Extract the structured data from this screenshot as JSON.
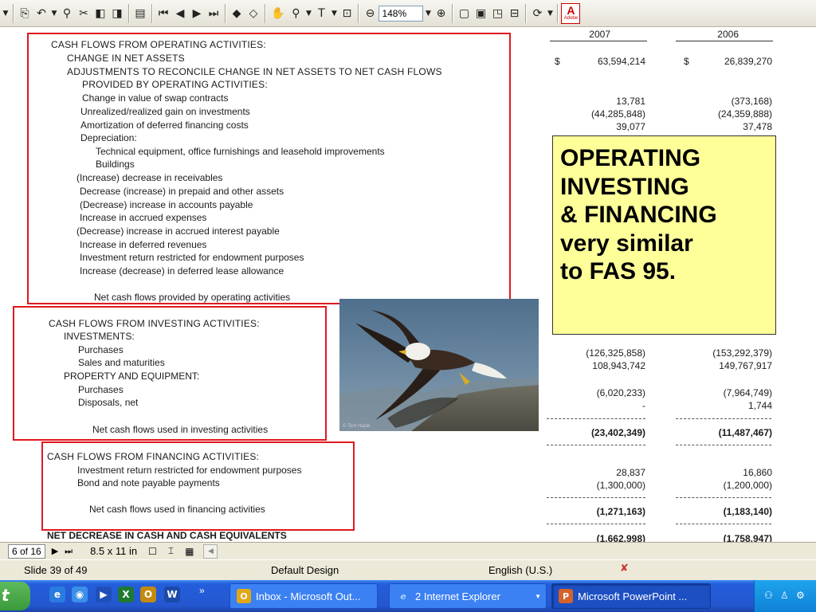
{
  "toolbar": {
    "zoom": "148%",
    "icons": [
      "dropdown-arrow-icon",
      "copy-icon",
      "undo-icon",
      "find-icon",
      "attach-icon",
      "insert-page-icon",
      "extract-page-icon",
      "pages-panel-icon",
      "first-page-icon",
      "prev-page-icon",
      "next-page-icon",
      "last-page-icon",
      "back-view-icon",
      "forward-view-icon",
      "hand-tool-icon",
      "zoom-tool-icon",
      "text-select-icon",
      "snapshot-icon",
      "zoom-out-icon",
      "zoom-in-icon",
      "actual-size-icon",
      "fit-page-icon",
      "fit-width-icon",
      "reflow-icon",
      "rotate-icon",
      "adobe-logo-icon"
    ],
    "adobe_label": "Adobe"
  },
  "columns": {
    "year1": "2007",
    "year2": "2006"
  },
  "operating": {
    "heading": "CASH FLOWS FROM OPERATING ACTIVITIES:",
    "change_net_assets": "CHANGE IN NET ASSETS",
    "adjustments_1": "ADJUSTMENTS TO RECONCILE CHANGE IN NET ASSETS TO NET CASH FLOWS",
    "adjustments_2": "PROVIDED BY OPERATING ACTIVITIES:",
    "swap": "Change in value of swap contracts",
    "gain": "Unrealized/realized gain on investments",
    "amortization": "Amortization of deferred financing costs",
    "depreciation": "Depreciation:",
    "technical": "Technical equipment, office furnishings and leasehold improvements",
    "buildings": "Buildings",
    "receivables": "(Increase) decrease in receivables",
    "prepaid": "Decrease (increase) in prepaid and other assets",
    "payable": "(Decrease) increase in accounts payable",
    "accrued": "Increase  in accrued expenses",
    "interest": "(Decrease) increase  in accrued interest payable",
    "deferred": "Increase  in deferred revenues",
    "endowment": "Investment return restricted for endowment purposes",
    "lease": "Increase (decrease) in deferred lease allowance",
    "net": "Net cash flows provided by operating activities"
  },
  "investing": {
    "heading": "CASH FLOWS FROM INVESTING ACTIVITIES:",
    "investments": "INVESTMENTS:",
    "purchases": "Purchases",
    "sales": "Sales and maturities",
    "property": "PROPERTY AND EQUIPMENT:",
    "purchases2": "Purchases",
    "disposals": "Disposals, net",
    "net": "Net cash flows used in investing activities"
  },
  "financing": {
    "heading": "CASH FLOWS FROM FINANCING ACTIVITIES:",
    "endowment": "Investment return restricted for endowment purposes",
    "bond": "Bond and note payable payments",
    "net": "Net cash flows used in financing activities",
    "decrease": "NET DECREASE IN CASH AND CASH EQUIVALENTS"
  },
  "values": {
    "change_net_assets": [
      "63,594,214",
      "26,839,270"
    ],
    "dollar": "$",
    "swap": [
      "13,781",
      "(373,168)"
    ],
    "gain": [
      "(44,285,848)",
      "(24,359,888)"
    ],
    "amortization": [
      "39,077",
      "37,478"
    ],
    "inv_purchases": [
      "(126,325,858)",
      "(153,292,379)"
    ],
    "inv_sales": [
      "108,943,742",
      "149,767,917"
    ],
    "prop_purchases": [
      "(6,020,233)",
      "(7,964,749)"
    ],
    "disposals": [
      "-",
      "1,744"
    ],
    "net_investing": [
      "(23,402,349)",
      "(11,487,467)"
    ],
    "fin_endowment": [
      "28,837",
      "16,860"
    ],
    "bond": [
      "(1,300,000)",
      "(1,200,000)"
    ],
    "net_financing": [
      "(1,271,163)",
      "(1,183,140)"
    ],
    "net_decrease": [
      "(1,662,998)",
      "(1,758,947)"
    ]
  },
  "callout": {
    "lines": [
      "OPERATING",
      "INVESTING",
      "& FINANCING",
      "very similar",
      "to FAS 95."
    ]
  },
  "photo": {
    "credit": "© Tom Hazel"
  },
  "reader_status": {
    "page": "6 of 16",
    "size": "8.5 x 11 in"
  },
  "ppt_status": {
    "slide": "Slide 39 of 49",
    "design": "Default Design",
    "language": "English (U.S.)"
  },
  "taskbar": {
    "start": "t",
    "more": "»",
    "tasks": [
      {
        "label": "Inbox - Microsoft Out...",
        "icon": "O"
      },
      {
        "label": "2 Internet Explorer",
        "icon": "e",
        "count": "2",
        "name": "Internet Explorer"
      },
      {
        "label": "Microsoft PowerPoint ...",
        "icon": "P"
      }
    ]
  }
}
